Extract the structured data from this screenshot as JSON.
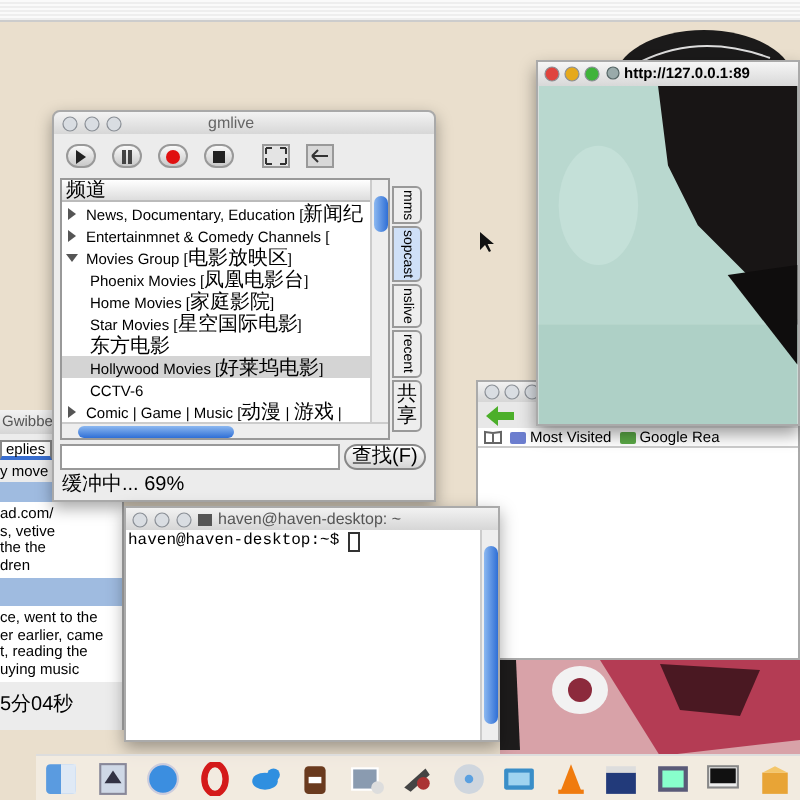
{
  "gmlive": {
    "title": "gmlive",
    "header": "频道",
    "channels": [
      {
        "label": "News, Documentary, Education [新闻纪",
        "expanded": false
      },
      {
        "label": "Entertainmnet & Comedy Channels [",
        "expanded": false
      },
      {
        "label": "Movies Group [电影放映区]",
        "expanded": true,
        "children": [
          {
            "label": "Phoenix Movies [凤凰电影台]",
            "selected": false
          },
          {
            "label": "Home Movies [家庭影院]",
            "selected": false
          },
          {
            "label": "Star Movies [星空国际电影]",
            "selected": false
          },
          {
            "label": "东方电影",
            "selected": false
          },
          {
            "label": "Hollywood Movies [好莱坞电影]",
            "selected": true
          },
          {
            "label": "CCTV-6",
            "selected": false
          }
        ]
      },
      {
        "label": "Comic | Game | Music [动漫 | 游戏 |",
        "expanded": false
      }
    ],
    "tabs": [
      {
        "label": "mms",
        "kind": "latin",
        "selected": false
      },
      {
        "label": "sopcast",
        "kind": "latin",
        "selected": true
      },
      {
        "label": "nslive",
        "kind": "latin",
        "selected": false
      },
      {
        "label": "recent",
        "kind": "latin",
        "selected": false
      },
      {
        "label": "共享",
        "kind": "cjk",
        "selected": false
      }
    ],
    "search_button": "查找(F)",
    "status": "缓冲中... 69%"
  },
  "gwibber": {
    "title": "Gwibbe",
    "tab": "eplies",
    "line": "y move",
    "messages": [
      {
        "lines": [
          "ad.com/",
          "s, vetive",
          "the the",
          "dren"
        ]
      },
      {
        "lines": [
          "ce, went to the",
          "er earlier, came",
          "t, reading the",
          "uying music"
        ]
      }
    ],
    "status": "5分04秒"
  },
  "video": {
    "title": "http://127.0.0.1:89"
  },
  "browser": {
    "bookmarks": [
      "Most Visited",
      "Google Rea"
    ]
  },
  "terminal": {
    "title": "haven@haven-desktop: ~",
    "prompt": "haven@haven-desktop:~$"
  }
}
